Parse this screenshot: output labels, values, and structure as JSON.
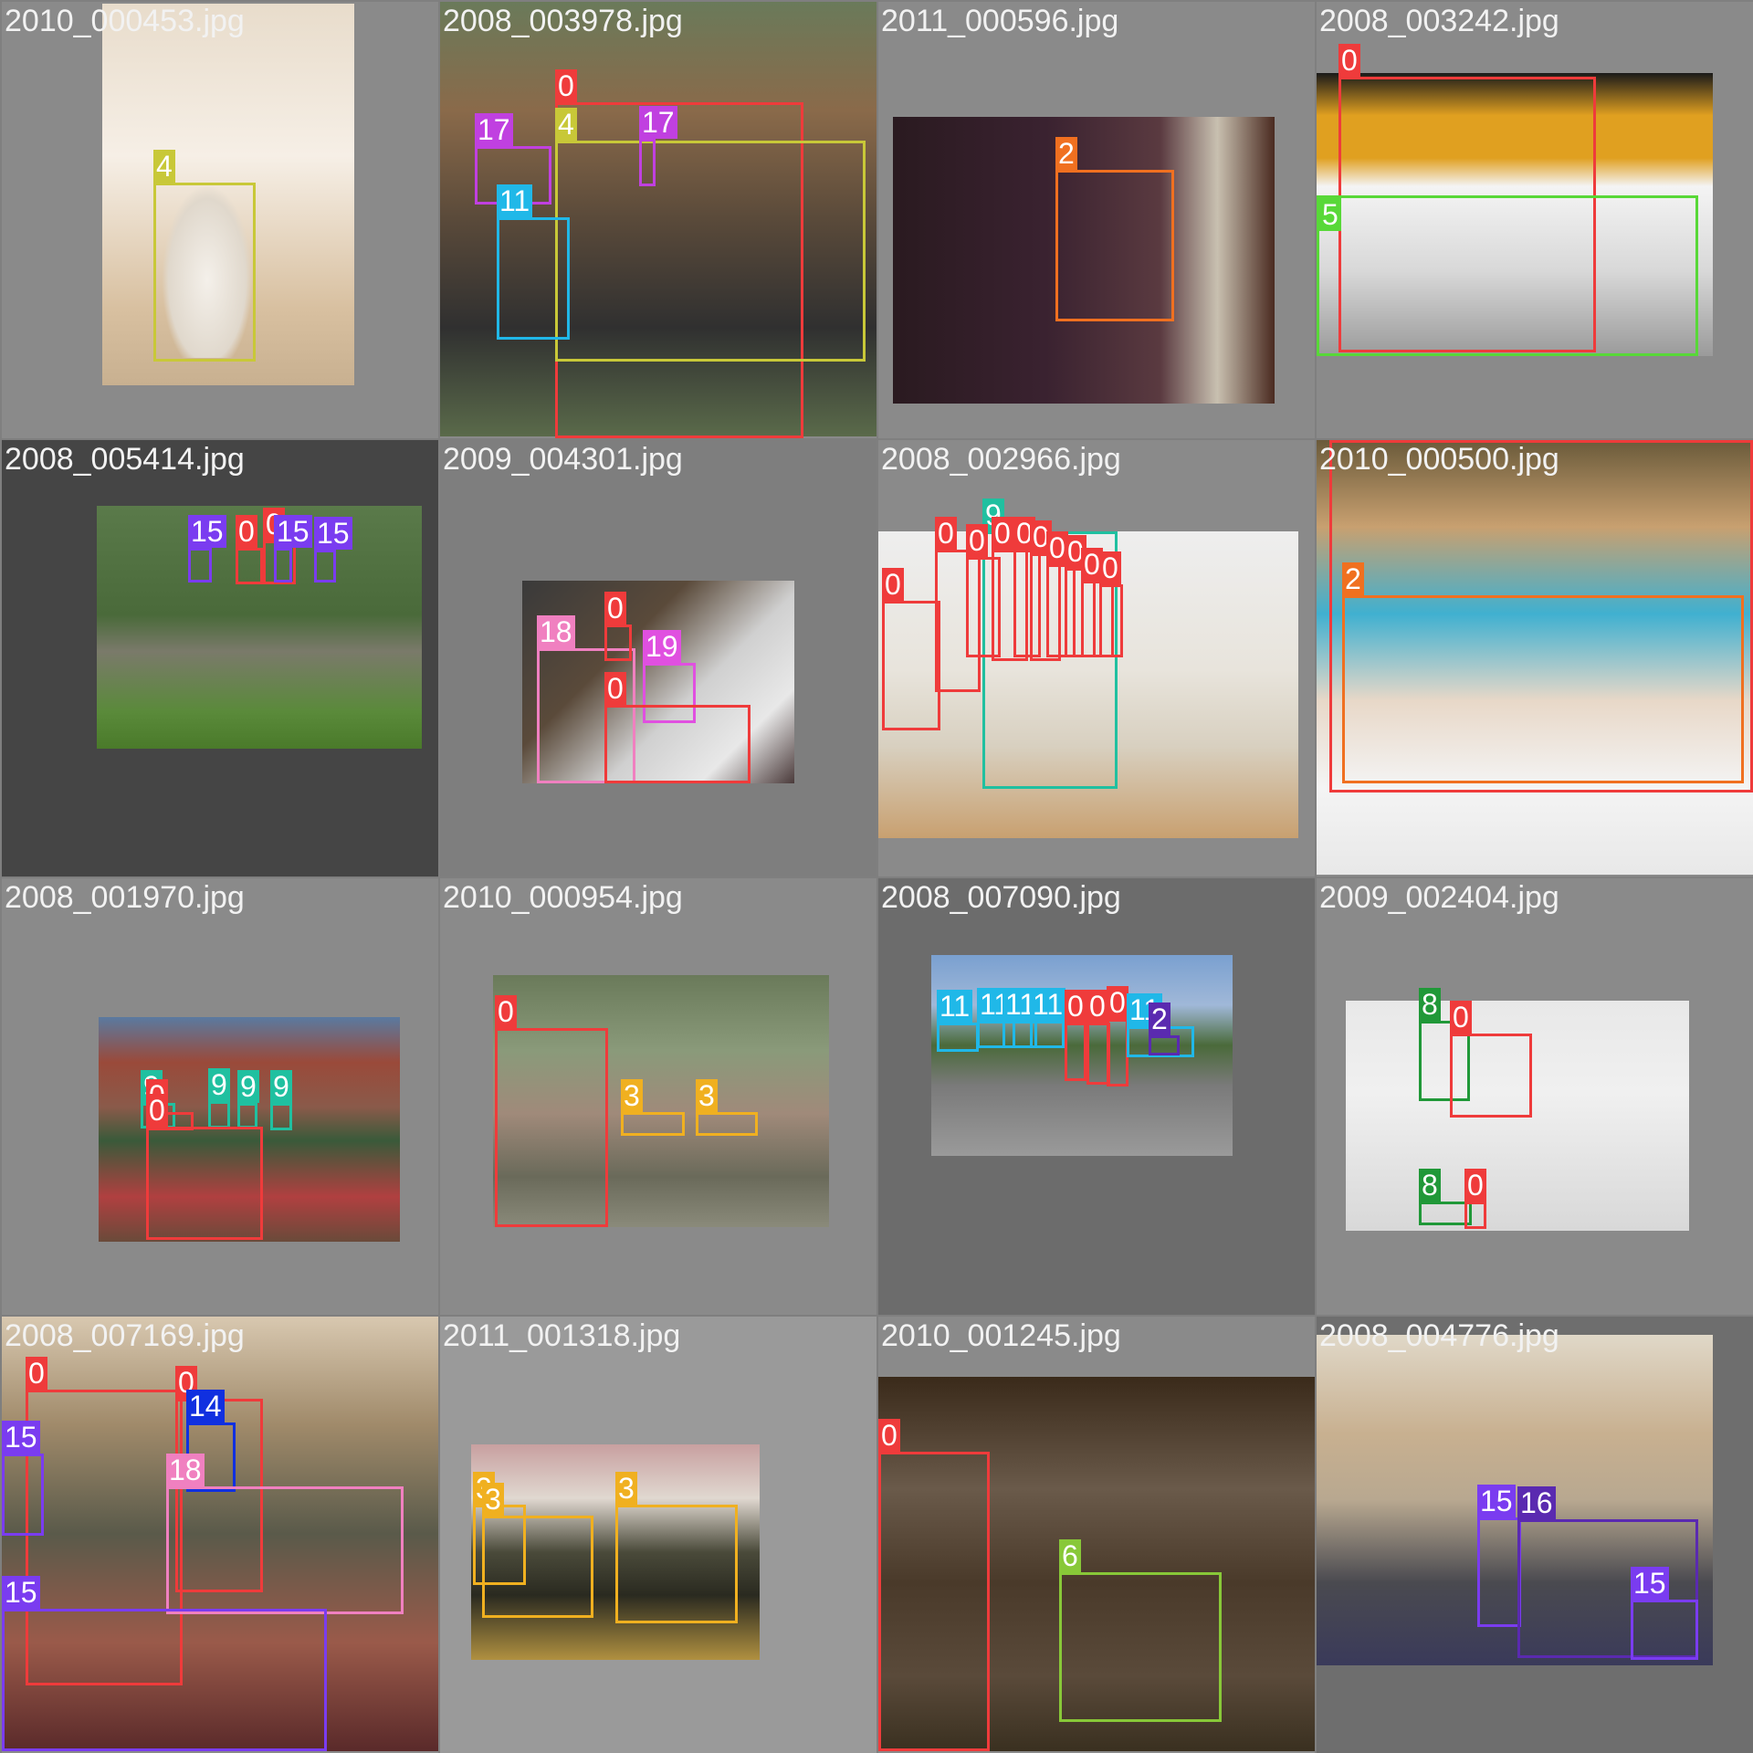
{
  "colors": {
    "0": "#ef3b3b",
    "2": "#f07020",
    "3": "#f0b020",
    "4": "#c8c838",
    "5": "#58d838",
    "6": "#88c838",
    "8": "#209838",
    "9": "#20c0a0",
    "11": "#20b8e8",
    "14": "#1030e0",
    "15": "#7a3cf0",
    "16": "#5a2ab0",
    "17": "#c040e0",
    "18": "#f080c0",
    "19": "#e050e0"
  },
  "tiles": [
    {
      "file": "2010_000453.jpg",
      "labels": [
        "4"
      ]
    },
    {
      "file": "2008_003978.jpg",
      "labels": [
        "0",
        "4",
        "17",
        "17",
        "11"
      ]
    },
    {
      "file": "2011_000596.jpg",
      "labels": [
        "2"
      ]
    },
    {
      "file": "2008_003242.jpg",
      "labels": [
        "0",
        "5"
      ]
    },
    {
      "file": "2008_005414.jpg",
      "labels": [
        "15",
        "0",
        "0",
        "15",
        "15"
      ]
    },
    {
      "file": "2009_004301.jpg",
      "labels": [
        "18",
        "0",
        "19",
        "0"
      ]
    },
    {
      "file": "2008_002966.jpg",
      "labels": [
        "9",
        "0",
        "0",
        "0",
        "0",
        "0",
        "0",
        "0",
        "0",
        "0",
        "0"
      ]
    },
    {
      "file": "2010_000500.jpg",
      "labels": [
        "0",
        "2"
      ]
    },
    {
      "file": "2008_001970.jpg",
      "labels": [
        "9",
        "9",
        "9",
        "9",
        "0",
        "0"
      ]
    },
    {
      "file": "2010_000954.jpg",
      "labels": [
        "0",
        "3",
        "3"
      ]
    },
    {
      "file": "2008_007090.jpg",
      "labels": [
        "11",
        "11",
        "11",
        "11",
        "0",
        "0",
        "0",
        "11",
        "2"
      ]
    },
    {
      "file": "2009_002404.jpg",
      "labels": [
        "8",
        "0",
        "8",
        "0"
      ]
    },
    {
      "file": "2008_007169.jpg",
      "labels": [
        "0",
        "0",
        "14",
        "15",
        "18",
        "15"
      ]
    },
    {
      "file": "2011_001318.jpg",
      "labels": [
        "3",
        "3",
        "3"
      ]
    },
    {
      "file": "2010_001245.jpg",
      "labels": [
        "0",
        "6"
      ]
    },
    {
      "file": "2008_004776.jpg",
      "labels": [
        "15",
        "16",
        "15"
      ]
    }
  ]
}
